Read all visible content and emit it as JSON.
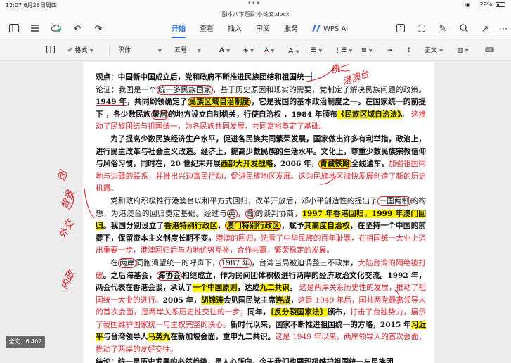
{
  "status": {
    "time_date": "12:07  6月26日周四",
    "battery": "29%",
    "wifi": "◉"
  },
  "window": {
    "title": "副本八下题目  小论文.docx"
  },
  "toolbar": {
    "tabs": [
      "开始",
      "查看",
      "插入",
      "审阅",
      "服务"
    ],
    "active_tab": "开始",
    "ai_label": "WPS AI"
  },
  "format": {
    "style_label": "格式",
    "font_value": "黑体",
    "size_value": "五号",
    "text_color_label": "A",
    "font_size_up_label": "A",
    "body_style": "正文"
  },
  "document": {
    "heading": "观点：中国新中国成立后，党和政府不断推进民族团结和祖国统一",
    "p1": [
      {
        "t": "论证：我国是一个"
      },
      {
        "t": "统一多民族国家",
        "c": "circ"
      },
      {
        "t": "，基于历史原因和现实的需要，党制定了解决民族问题的政策。"
      },
      {
        "t": "1949 年",
        "c": "b under"
      },
      {
        "t": "，共同纲领确定了",
        "c": "b"
      },
      {
        "t": "民族区域自治制度",
        "c": "b hl circ"
      },
      {
        "t": "，它是我国的基本政治制度之一。在国家统一的前提下 ，各少数民族",
        "c": "b"
      },
      {
        "t": "聚居",
        "c": "b circ"
      },
      {
        "t": "的地方设立自制机关，行使自治权 ，1984 年颁布",
        "c": "b"
      },
      {
        "t": "《民族区域自治法》",
        "c": "b hl"
      },
      {
        "t": "。",
        "c": "b"
      },
      {
        "t": " 这推动了民族团结与祖国统一，为各民族共同发展，共同富裕奠定了基础。",
        "c": "red"
      }
    ],
    "p2": [
      {
        "t": "为了提高少数民族经济生产水平，促进各民族共同繁荣发展，国家做出许多有利举措，政治上，进行民主改革与社会主义改造。经济上，提高少数民族的生活水平。文化上，尊重少数民族宗教信仰与风俗习惯，同时在，20 世纪末开展",
        "c": "b"
      },
      {
        "t": "西部大开发战略",
        "c": "b hl"
      },
      {
        "t": "，2006 年，",
        "c": "b"
      },
      {
        "t": "青藏铁路",
        "c": "b hl circ"
      },
      {
        "t": "全线通车，",
        "c": "b"
      },
      {
        "t": "加强祖国内地与边疆的联系，并推出兴边富民行动，促进民族地区发展。这为民族地区加快发展创造了新的历史机遇。",
        "c": "red"
      }
    ],
    "p3": [
      {
        "t": "党和政府积极推行港澳台以和平方式回归，改革开放后，邓小平创造性的提出了"
      },
      {
        "t": "一国两制",
        "c": "circ"
      },
      {
        "t": "的构想，为港澳台的回归奠定基础。经过与"
      },
      {
        "t": "英",
        "c": "circ"
      },
      {
        "t": "，"
      },
      {
        "t": "葡",
        "c": "circ"
      },
      {
        "t": "的谈判协商，"
      },
      {
        "t": "1997 年香港回归，1999 年澳门回归",
        "c": "b hl"
      },
      {
        "t": "。我国分别设立了",
        "c": "b"
      },
      {
        "t": "香港特别行政区",
        "c": "b hl"
      },
      {
        "t": "，",
        "c": "b"
      },
      {
        "t": "澳门特别行政区",
        "c": "b hl circ"
      },
      {
        "t": "，赋予",
        "c": "b"
      },
      {
        "t": "其高度自治权",
        "c": "b hl"
      },
      {
        "t": "，在坚持一个中国的前提下，保留资本主义制度长期不变。",
        "c": "b"
      },
      {
        "t": "港澳的回归，洗雪了中华民族的百年耻辱，在祖国统一大业上迈出重要一步，港澳回归后与内地优势互补，合作共赢，繁荣稳定的发展。",
        "c": "red"
      }
    ],
    "p4": [
      {
        "t": "在"
      },
      {
        "t": "两岸",
        "c": "circ"
      },
      {
        "t": "同胞渴望统一的呼声下，"
      },
      {
        "t": "1987 年",
        "c": "circ"
      },
      {
        "t": "，台湾当局被迫调整三不政策，"
      },
      {
        "t": "大陆台湾的隔绝被打破",
        "c": "red"
      },
      {
        "t": "。之后海基会，",
        "c": "b"
      },
      {
        "t": "海协会",
        "c": "b circ"
      },
      {
        "t": "相继成立，作为民间团体积极进行两岸的经济政治文化交流。1992 年，两会代表在香港会谈，承认了",
        "c": "b"
      },
      {
        "t": "一个中国原则",
        "c": "b hl"
      },
      {
        "t": "，达成",
        "c": "b"
      },
      {
        "t": "九二共识",
        "c": "b hl"
      },
      {
        "t": "。",
        "c": "b"
      },
      {
        "t": " 这是两岸关系历史性的发展，推动了祖国统一大业的进行。",
        "c": "red"
      },
      {
        "t": "2005 年，",
        "c": "b"
      },
      {
        "t": "胡锦涛",
        "c": "b hl"
      },
      {
        "t": "会见国民党主席",
        "c": "b"
      },
      {
        "t": "连战",
        "c": "b hl"
      },
      {
        "t": "，",
        "c": "b"
      },
      {
        "t": "这是 1949 年后，国共两党最高领导人的首次会面，是两岸关系历史性交往的一步；",
        "c": "red"
      },
      {
        "t": "同年，",
        "c": "b"
      },
      {
        "t": "《反分裂国家法》",
        "c": "b hl"
      },
      {
        "t": "颁布，",
        "c": "b"
      },
      {
        "t": "打击了台独势力，展示了我国维护国家统一与主权完整的决心。",
        "c": "red"
      },
      {
        "t": "新时代以来，国家不断推进祖国统一的方略，2015 年",
        "c": "b"
      },
      {
        "t": "习近平",
        "c": "b hl"
      },
      {
        "t": "与台湾领导人",
        "c": "b"
      },
      {
        "t": "马英九",
        "c": "b hl"
      },
      {
        "t": "在新加坡会面，重申九二共识。",
        "c": "b"
      },
      {
        "t": "这是 1949 年以来，两岸领导人的首次会面，推动了两岸的友好交往。",
        "c": "red"
      }
    ],
    "conclusion": "结论：统一是历史发展的必然趋势，是人心所向。今天我们也要积极维护祖国统一与民族团"
  },
  "annotations": [
    "统一",
    "港澳台",
    "团",
    "背景",
    "外交",
    "内政"
  ],
  "word_count": "全文：6,402",
  "colors": {
    "accent": "#1f6fe0",
    "highlight": "#fff200",
    "annotation_red": "#d9242b"
  }
}
